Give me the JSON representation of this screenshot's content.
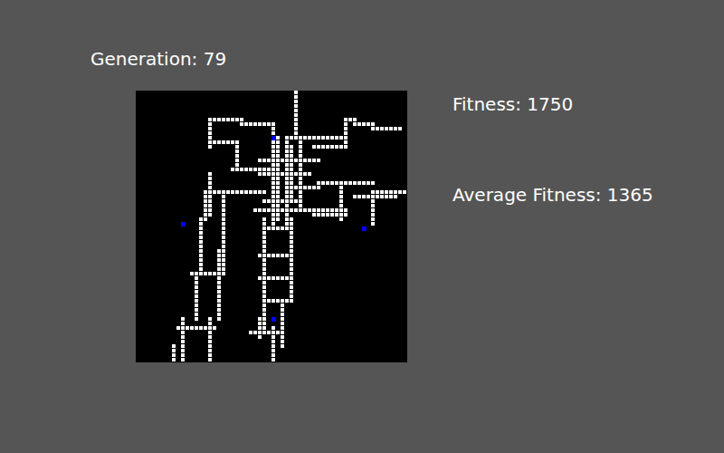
{
  "generation": "Generation: 79",
  "fitness": "Fitness: 1750",
  "average_fitness": "Average Fitness: 1365",
  "grid": {
    "cols": 60,
    "rows": 60,
    "path_segments": [
      [
        35,
        0,
        35,
        10
      ],
      [
        16,
        6,
        23,
        6
      ],
      [
        23,
        7,
        30,
        7
      ],
      [
        30,
        7,
        30,
        12
      ],
      [
        46,
        6,
        46,
        12
      ],
      [
        46,
        6,
        48,
        6
      ],
      [
        48,
        7,
        52,
        7
      ],
      [
        52,
        8,
        58,
        8
      ],
      [
        33,
        10,
        46,
        10
      ],
      [
        39,
        12,
        46,
        12
      ],
      [
        16,
        6,
        16,
        12
      ],
      [
        16,
        11,
        22,
        11
      ],
      [
        22,
        11,
        22,
        17
      ],
      [
        30,
        12,
        30,
        30
      ],
      [
        31,
        10,
        31,
        28
      ],
      [
        33,
        10,
        33,
        30
      ],
      [
        36,
        10,
        36,
        26
      ],
      [
        34,
        12,
        34,
        24
      ],
      [
        27,
        15,
        40,
        15
      ],
      [
        27,
        18,
        38,
        18
      ],
      [
        28,
        24,
        36,
        24
      ],
      [
        26,
        26,
        40,
        26
      ],
      [
        38,
        26,
        46,
        26
      ],
      [
        21,
        17,
        30,
        17
      ],
      [
        15,
        22,
        28,
        22
      ],
      [
        34,
        21,
        40,
        21
      ],
      [
        40,
        20,
        52,
        20
      ],
      [
        52,
        22,
        59,
        22
      ],
      [
        48,
        23,
        57,
        23
      ],
      [
        45,
        20,
        45,
        28
      ],
      [
        39,
        27,
        46,
        27
      ],
      [
        52,
        23,
        52,
        29
      ],
      [
        16,
        18,
        16,
        27
      ],
      [
        15,
        22,
        15,
        28
      ],
      [
        14,
        28,
        14,
        40
      ],
      [
        13,
        40,
        13,
        50
      ],
      [
        10,
        50,
        10,
        59
      ],
      [
        8,
        56,
        8,
        59
      ],
      [
        19,
        23,
        19,
        40
      ],
      [
        18,
        35,
        18,
        50
      ],
      [
        16,
        50,
        16,
        59
      ],
      [
        12,
        40,
        18,
        40
      ],
      [
        9,
        52,
        17,
        52
      ],
      [
        28,
        28,
        28,
        52
      ],
      [
        27,
        50,
        27,
        54
      ],
      [
        25,
        53,
        31,
        53
      ],
      [
        30,
        52,
        30,
        59
      ],
      [
        34,
        28,
        34,
        46
      ],
      [
        28,
        46,
        34,
        46
      ],
      [
        32,
        46,
        32,
        56
      ],
      [
        28,
        30,
        34,
        30
      ],
      [
        27,
        36,
        34,
        36
      ],
      [
        27,
        41,
        33,
        41
      ]
    ],
    "targets": [
      {
        "col": 30,
        "row": 10
      },
      {
        "col": 10,
        "row": 29
      },
      {
        "col": 50,
        "row": 30
      },
      {
        "col": 30,
        "row": 50
      }
    ]
  }
}
